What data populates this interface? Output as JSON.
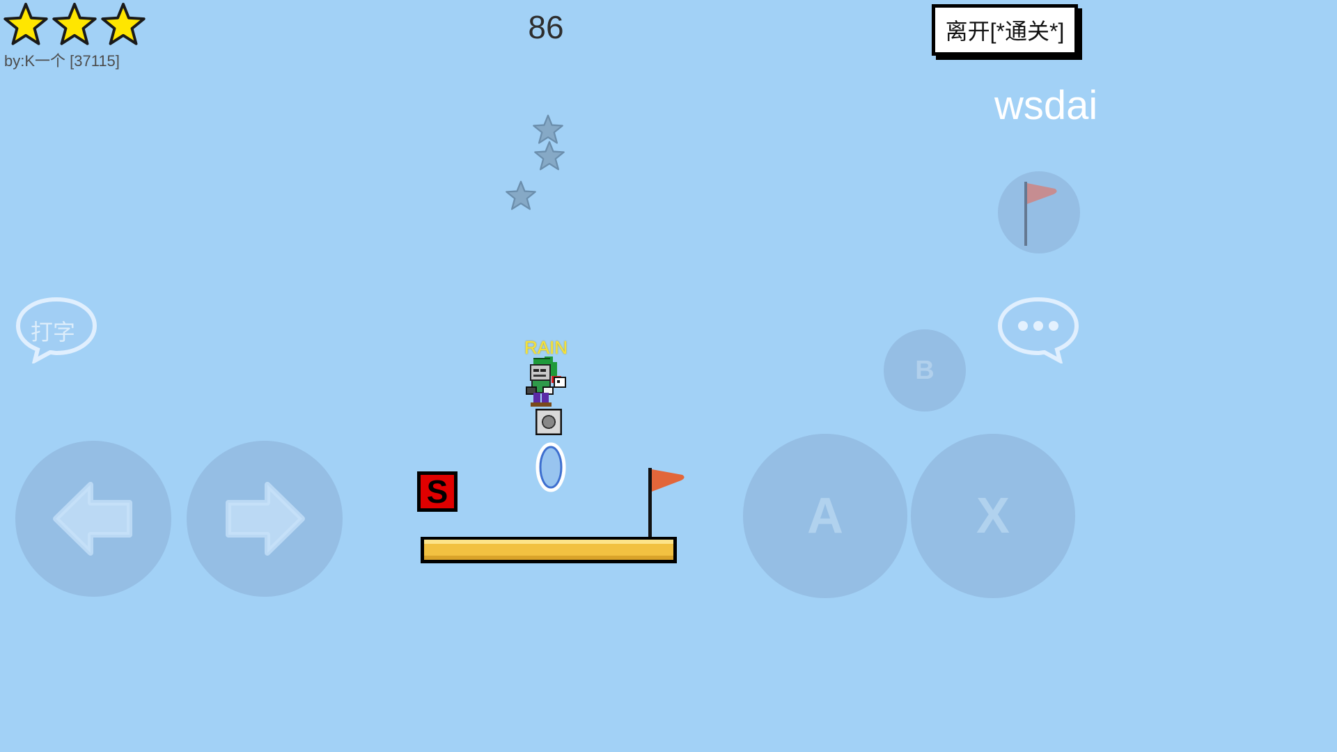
{
  "hud": {
    "stars_earned": 3,
    "stars_total": 3,
    "author": "by:K一个 [37115]",
    "timer": "86",
    "exit_label": "离开[*通关*]",
    "other_player": "wsdai"
  },
  "player": {
    "name": "RAIN"
  },
  "level": {
    "checkpoint_block_label": "S"
  },
  "controls": {
    "chat_left_label": "打字",
    "b_label": "B",
    "a_label": "A",
    "x_label": "X"
  },
  "colors": {
    "sky": "#a2d1f6",
    "star_gold": "#ffe600",
    "platform": "#f2c141",
    "flag": "#e2663a",
    "block_red": "#e00000",
    "player_name": "#f6e23a"
  }
}
